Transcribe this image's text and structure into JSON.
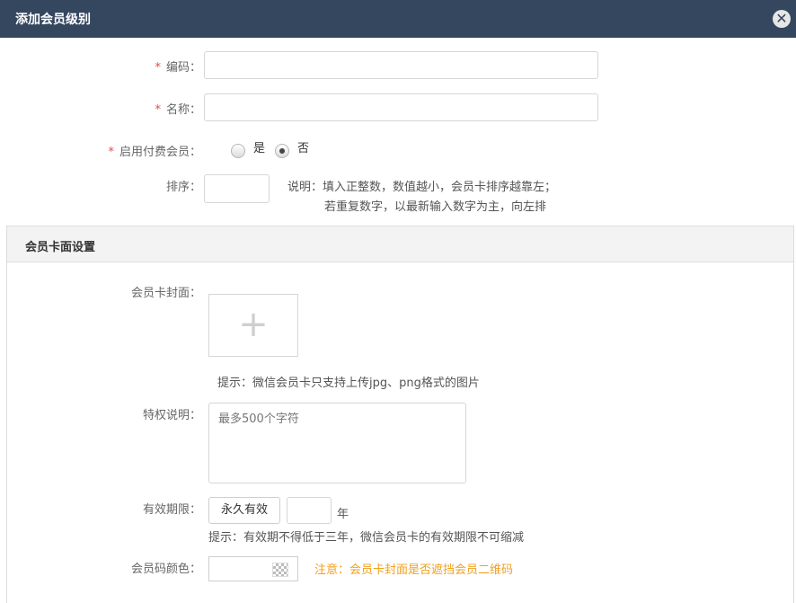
{
  "dialog": {
    "title": "添加会员级别",
    "close_icon": "close-icon"
  },
  "form": {
    "code_label": "编码：",
    "code_value": "",
    "name_label": "名称：",
    "name_value": "",
    "paid_label": "启用付费会员：",
    "paid_yes": "是",
    "paid_no": "否",
    "paid_selected": "否",
    "sort_label": "排序：",
    "sort_value": "",
    "sort_note_1": "说明：填入正整数，数值越小，会员卡排序越靠左；",
    "sort_note_2": "若重复数字，以最新输入数字为主，向左排",
    "required_mark": "*"
  },
  "card_section": {
    "title": "会员卡面设置",
    "cover_label": "会员卡封面：",
    "upload_icon": "plus-icon",
    "cover_hint": "提示：微信会员卡只支持上传jpg、png格式的图片",
    "privilege_label": "特权说明：",
    "privilege_placeholder": "最多500个字符",
    "validity_label": "有效期限：",
    "validity_button": "永久有效",
    "validity_years": "",
    "validity_unit": "年",
    "validity_hint": "提示：有效期不得低于三年，微信会员卡的有效期限不可缩减",
    "color_label": "会员码颜色：",
    "color_warning": "注意：会员卡封面是否遮挡会员二维码"
  },
  "colors": {
    "titlebar": "#35465f",
    "required": "#e54b4b",
    "warning": "#f0a020"
  }
}
